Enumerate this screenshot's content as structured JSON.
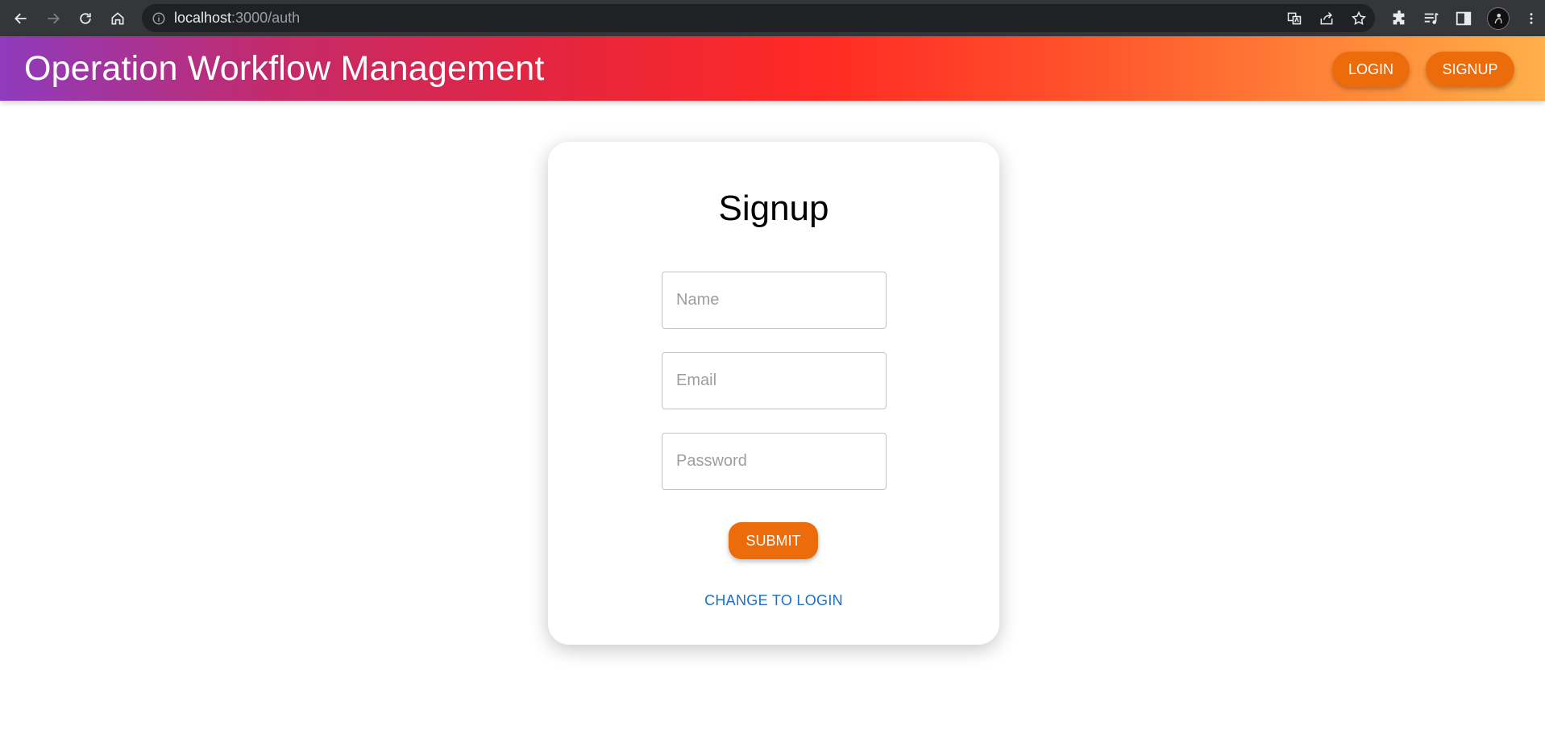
{
  "browser": {
    "url_host": "localhost",
    "url_path": ":3000/auth",
    "icons": [
      "back-arrow-icon",
      "forward-arrow-icon",
      "reload-icon",
      "home-icon",
      "info-icon",
      "translate-icon",
      "share-icon",
      "star-icon",
      "extensions-icon",
      "media-queue-icon",
      "side-panel-icon",
      "profile-avatar",
      "more-menu-icon"
    ]
  },
  "header": {
    "title": "Operation Workflow Management",
    "login_label": "LOGIN",
    "signup_label": "SIGNUP",
    "accent": "#ec6c0b"
  },
  "form": {
    "title": "Signup",
    "name_placeholder": "Name",
    "email_placeholder": "Email",
    "password_placeholder": "Password",
    "name_value": "",
    "email_value": "",
    "password_value": "",
    "submit_label": "SUBMIT",
    "switch_label": "CHANGE TO LOGIN",
    "link_color": "#1f70c1"
  }
}
